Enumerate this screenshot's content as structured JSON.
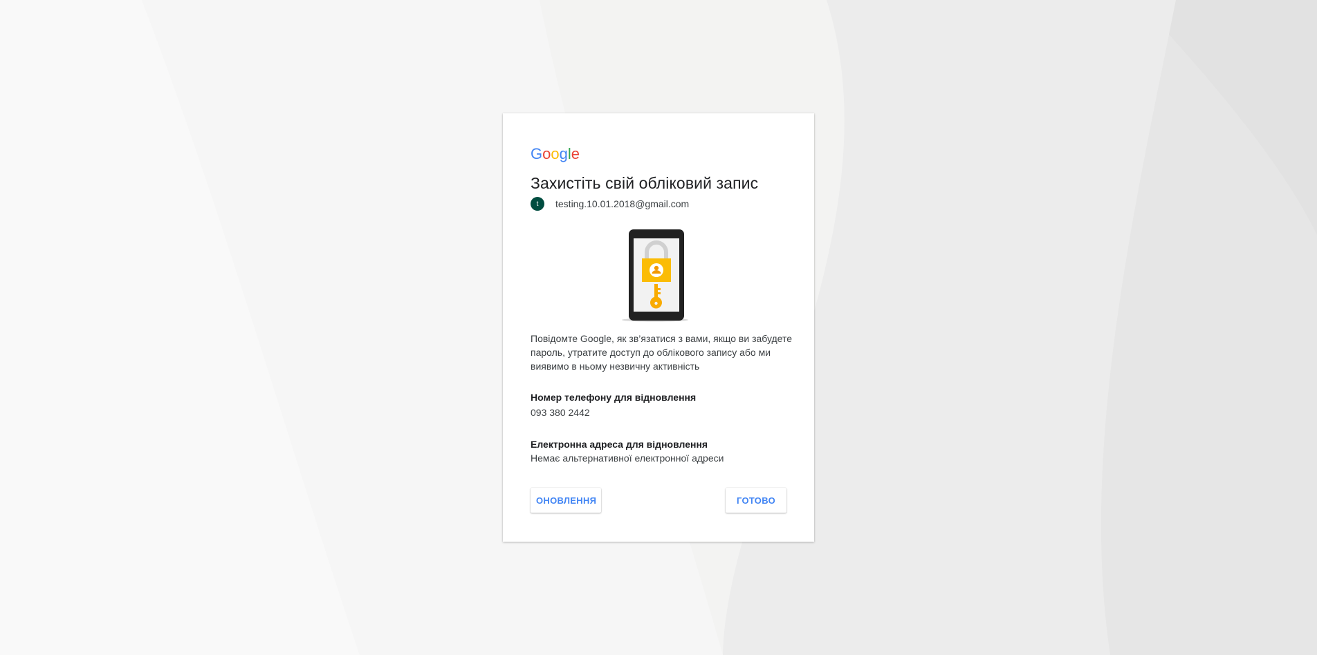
{
  "logo": {
    "letters": [
      "G",
      "o",
      "o",
      "g",
      "l",
      "e"
    ],
    "colors": [
      "#4285f4",
      "#ea4335",
      "#fbbc05",
      "#4285f4",
      "#34a853",
      "#ea4335"
    ]
  },
  "title": "Захистіть свій обліковий запис",
  "account": {
    "avatar_letter": "t",
    "avatar_color": "#004d40",
    "email": "testing.10.01.2018@gmail.com"
  },
  "illustration": {
    "icon": "phone-lock-key-icon",
    "accent_color": "#fbbc05"
  },
  "description": "Повідомте Google, як зв’язатися з вами, якщо ви забудете пароль, утратите доступ до облікового запису або ми виявимо в ньому незвичну активність",
  "recovery_phone": {
    "label": "Номер телефону для відновлення",
    "value": "093 380 2442"
  },
  "recovery_email": {
    "label": "Електронна адреса для відновлення",
    "value": "Немає альтернативної електронної адреси"
  },
  "buttons": {
    "update": "ОНОВЛЕННЯ",
    "done": "ГОТОВО"
  },
  "colors": {
    "accent": "#4285f4",
    "background": "#f4f4f3"
  }
}
